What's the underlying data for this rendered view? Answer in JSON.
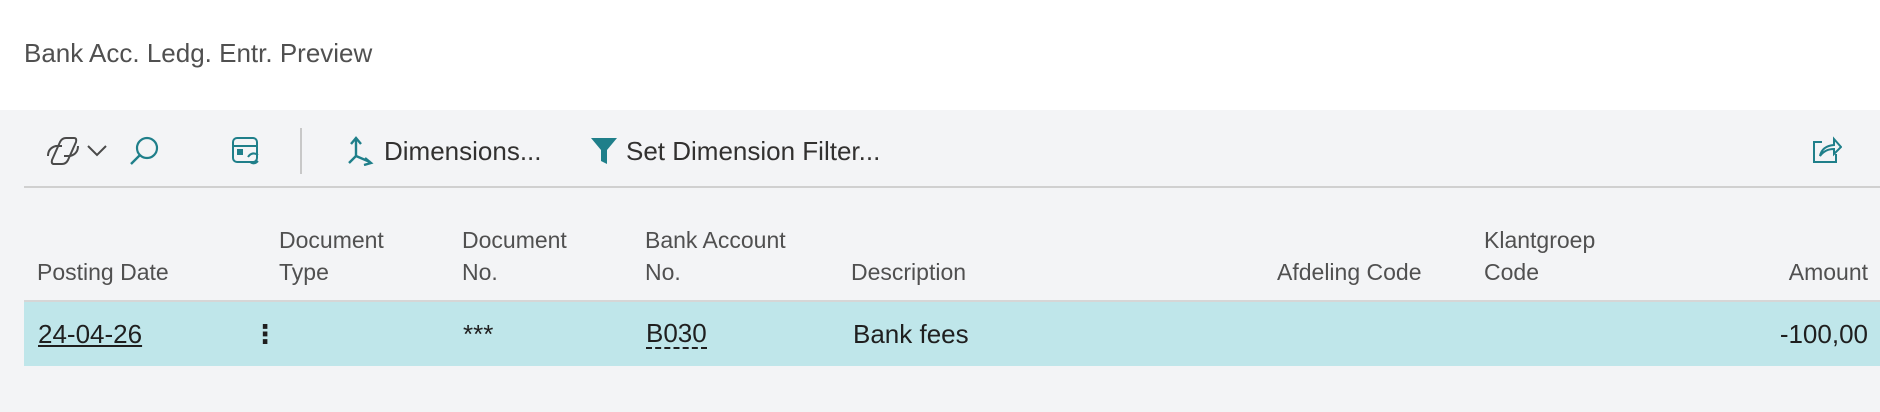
{
  "page": {
    "title": "Bank Acc. Ledg. Entr. Preview"
  },
  "toolbar": {
    "copilot_icon": "copilot-icon",
    "dropdown_icon": "chevron-down-icon",
    "search_icon": "search-icon",
    "layout_icon": "layout-refresh-icon",
    "dimensions_label": "Dimensions...",
    "dimensions_icon": "dimensions-icon",
    "set_dim_filter_label": "Set Dimension Filter...",
    "filter_icon": "funnel-icon",
    "share_icon": "share-icon",
    "accent_color": "#1f8f8f"
  },
  "table": {
    "columns": {
      "posting_date": "Posting Date",
      "document_type_l1": "Document",
      "document_type_l2": "Type",
      "document_no_l1": "Document",
      "document_no_l2": "No.",
      "bank_account_no_l1": "Bank Account",
      "bank_account_no_l2": "No.",
      "description": "Description",
      "afdeling_code": "Afdeling Code",
      "klantgroep_code_l1": "Klantgroep",
      "klantgroep_code_l2": "Code",
      "amount": "Amount"
    },
    "rows": [
      {
        "posting_date": "24-04-26",
        "menu": "⋮",
        "document_type": "",
        "document_no": "***",
        "bank_account_no": "B030",
        "description": "Bank fees",
        "afdeling_code": "",
        "klantgroep_code": "",
        "amount": "-100,00"
      }
    ],
    "selected_row_color": "#bfe6ea"
  }
}
